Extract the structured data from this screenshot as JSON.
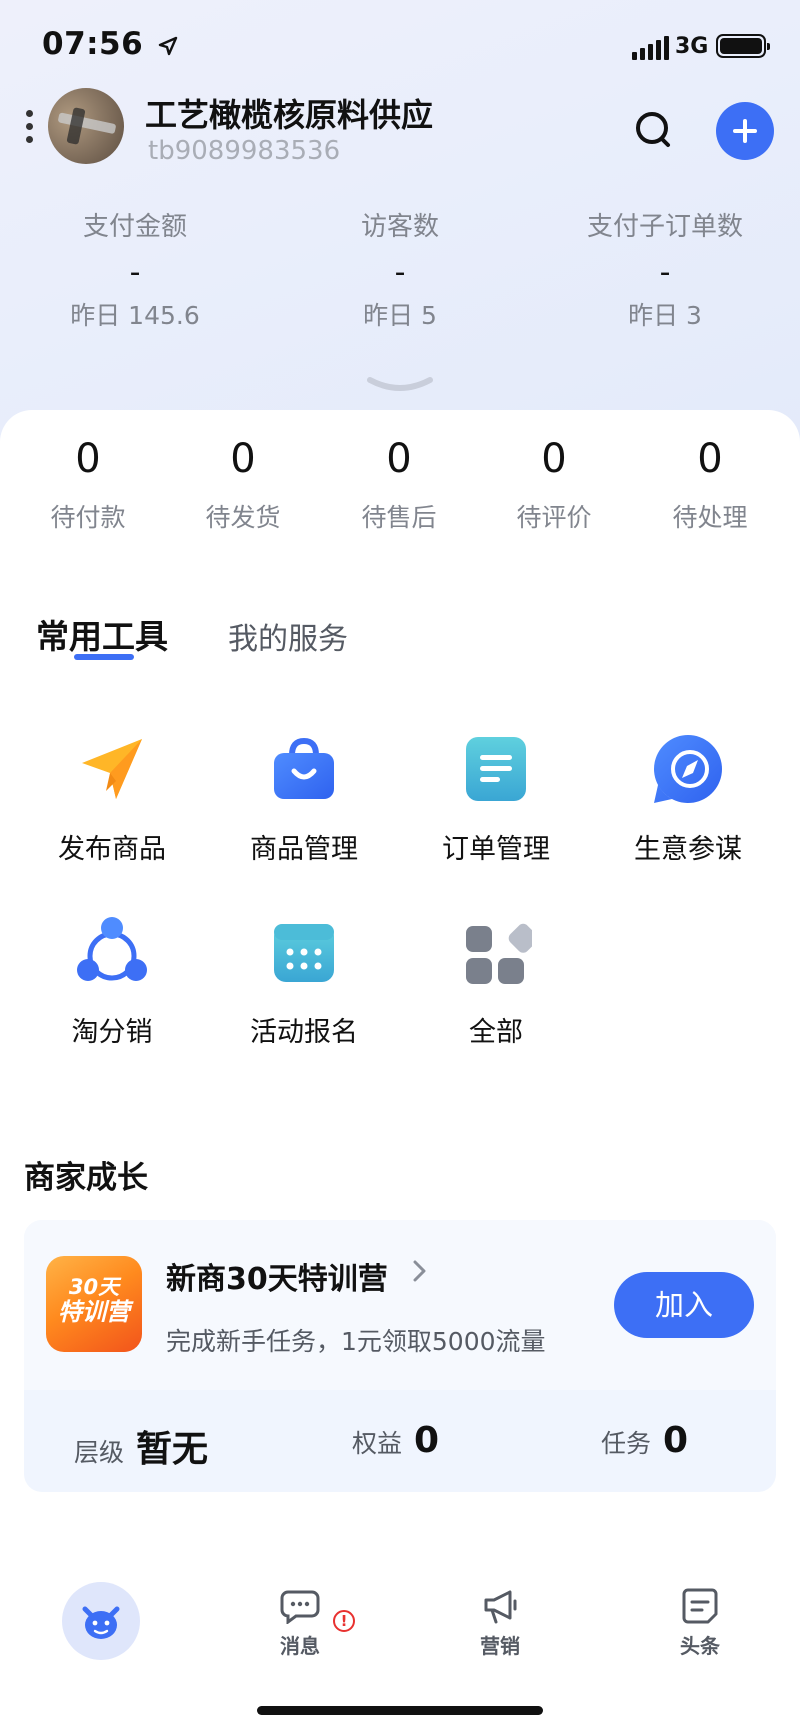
{
  "status_bar": {
    "time": "07:56",
    "network": "3G"
  },
  "header": {
    "shop_name": "工艺橄榄核原料供应",
    "shop_id": "tb9089983536"
  },
  "stats": [
    {
      "label": "支付金额",
      "value": "-",
      "yesterday": "昨日 145.6"
    },
    {
      "label": "访客数",
      "value": "-",
      "yesterday": "昨日 5"
    },
    {
      "label": "支付子订单数",
      "value": "-",
      "yesterday": "昨日 3"
    }
  ],
  "orders": [
    {
      "count": "0",
      "label": "待付款"
    },
    {
      "count": "0",
      "label": "待发货"
    },
    {
      "count": "0",
      "label": "待售后"
    },
    {
      "count": "0",
      "label": "待评价"
    },
    {
      "count": "0",
      "label": "待处理"
    }
  ],
  "tabs": {
    "active": "常用工具",
    "inactive": "我的服务"
  },
  "tools": [
    {
      "label": "发布商品",
      "icon": "paper-plane-icon"
    },
    {
      "label": "商品管理",
      "icon": "shopping-bag-icon"
    },
    {
      "label": "订单管理",
      "icon": "document-list-icon"
    },
    {
      "label": "生意参谋",
      "icon": "compass-icon"
    },
    {
      "label": "淘分销",
      "icon": "share-network-icon"
    },
    {
      "label": "活动报名",
      "icon": "calendar-icon"
    },
    {
      "label": "全部",
      "icon": "grid-apps-icon"
    }
  ],
  "growth": {
    "section_title": "商家成长",
    "campaign_badge_line1": "30天",
    "campaign_badge_line2": "特训营",
    "campaign_title": "新商30天特训营",
    "campaign_subtitle": "完成新手任务，1元领取5000流量",
    "join_label": "加入",
    "level_label": "层级",
    "level_value": "暂无",
    "rights_label": "权益",
    "rights_value": "0",
    "tasks_label": "任务",
    "tasks_value": "0"
  },
  "bottom_nav": {
    "messages": "消息",
    "marketing": "营销",
    "headlines": "头条",
    "alert_mark": "!"
  },
  "colors": {
    "accent": "#3d6ff5",
    "alert": "#e8312f"
  }
}
